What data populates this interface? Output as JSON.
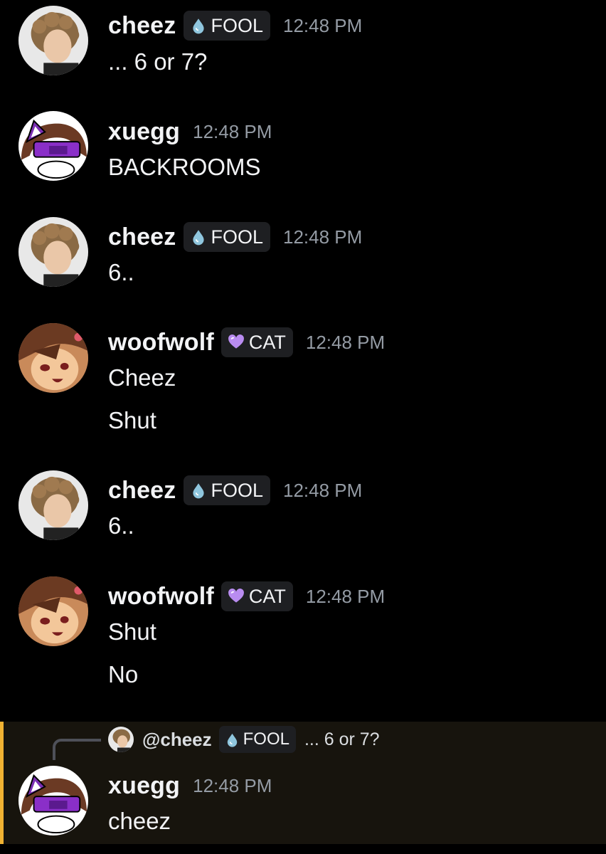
{
  "messages": [
    {
      "author": "cheez",
      "avatar_icon": "curly-hair-portrait-avatar",
      "badge": {
        "icon": "water-drop-icon",
        "label": "FOOL"
      },
      "time": "12:48 PM",
      "lines": [
        "... 6 or 7?"
      ]
    },
    {
      "author": "xuegg",
      "avatar_icon": "purple-cat-ear-avatar",
      "badge": null,
      "time": "12:48 PM",
      "lines": [
        "BACKROOMS"
      ]
    },
    {
      "author": "cheez",
      "avatar_icon": "curly-hair-portrait-avatar",
      "badge": {
        "icon": "water-drop-icon",
        "label": "FOOL"
      },
      "time": "12:48 PM",
      "lines": [
        "6.."
      ]
    },
    {
      "author": "woofwolf",
      "avatar_icon": "anime-wolf-girl-avatar",
      "badge": {
        "icon": "purple-heart-icon",
        "label": "CAT"
      },
      "time": "12:48 PM",
      "lines": [
        "Cheez",
        "Shut"
      ]
    },
    {
      "author": "cheez",
      "avatar_icon": "curly-hair-portrait-avatar",
      "badge": {
        "icon": "water-drop-icon",
        "label": "FOOL"
      },
      "time": "12:48 PM",
      "lines": [
        "6.."
      ]
    },
    {
      "author": "woofwolf",
      "avatar_icon": "anime-wolf-girl-avatar",
      "badge": {
        "icon": "purple-heart-icon",
        "label": "CAT"
      },
      "time": "12:48 PM",
      "lines": [
        "Shut",
        "No"
      ]
    },
    {
      "author": "xuegg",
      "avatar_icon": "purple-cat-ear-avatar",
      "badge": null,
      "time": "12:48 PM",
      "lines": [
        "cheez"
      ],
      "reply_to": {
        "mention": "@cheez",
        "badge": {
          "icon": "water-drop-icon",
          "label": "FOOL"
        },
        "preview": "... 6 or 7?"
      }
    }
  ],
  "colors": {
    "background": "#000000",
    "text": "#f2f3f5",
    "timestamp": "#949ba4",
    "badge_bg": "#1e1f22",
    "reply_highlight_bg": "#17140d",
    "reply_bar": "#f0b232",
    "fool_drop": "#8fc6de",
    "cat_heart": "#b98cf0"
  }
}
